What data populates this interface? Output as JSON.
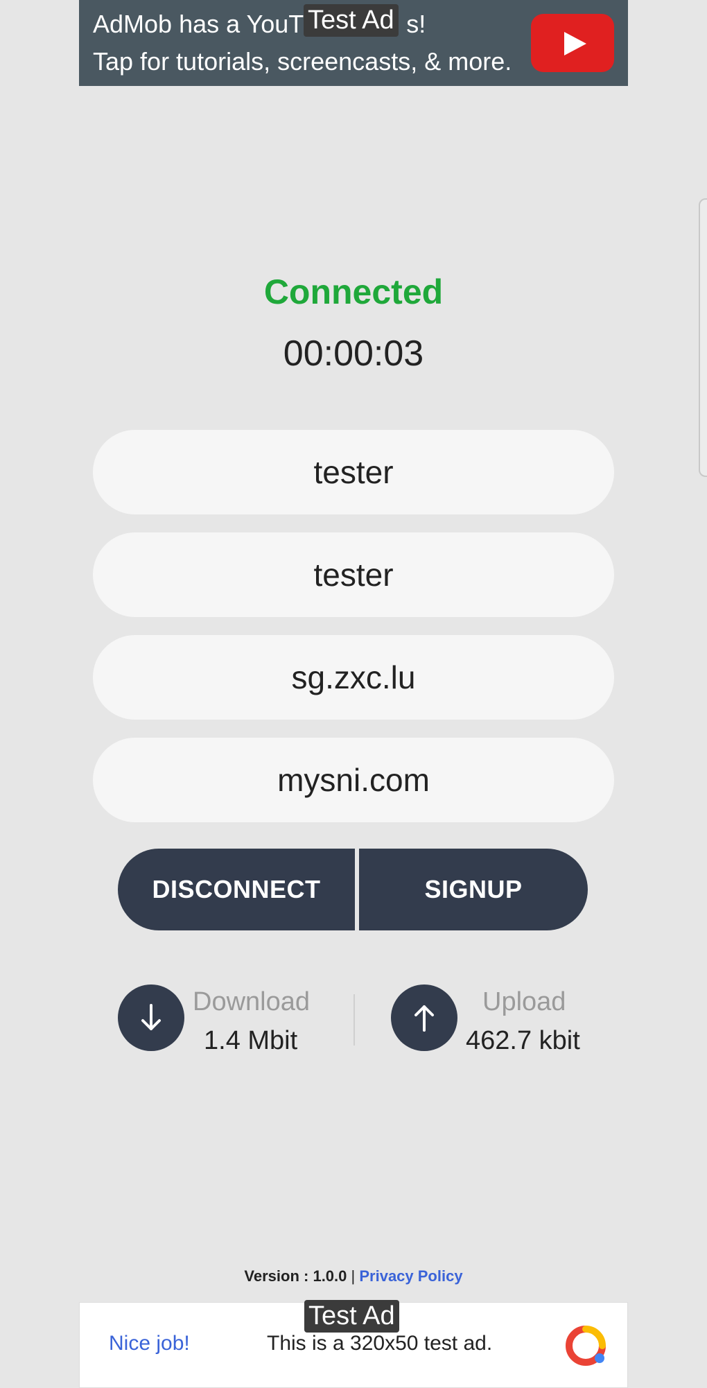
{
  "top_ad": {
    "line1": "AdMob has a YouTube channel with videos!",
    "line1_visible": "AdMob has a YouT",
    "line1_end": "s!",
    "line2": "Tap for tutorials, screencasts, & more.",
    "tag": "Test Ad",
    "icon": "youtube-play-icon"
  },
  "status": {
    "text": "Connected",
    "color": "#1fa83a",
    "timer": "00:00:03"
  },
  "fields": {
    "username": "tester",
    "password": "tester",
    "server": "sg.zxc.lu",
    "sni": "mysni.com"
  },
  "buttons": {
    "disconnect": "DISCONNECT",
    "signup": "SIGNUP"
  },
  "stats": {
    "download_label": "Download",
    "download_value": "1.4 Mbit",
    "upload_label": "Upload",
    "upload_value": "462.7 kbit"
  },
  "footer": {
    "version": "Version : 1.0.0",
    "separator": "|",
    "privacy": "Privacy Policy"
  },
  "bottom_ad": {
    "tag": "Test Ad",
    "nice": "Nice job!",
    "message": "This is a 320x50 test ad.",
    "icon": "admob-logo-icon"
  },
  "colors": {
    "background": "#e6e6e6",
    "button": "#333c4d",
    "link": "#3a63d8",
    "ad_banner": "#4a5861"
  }
}
